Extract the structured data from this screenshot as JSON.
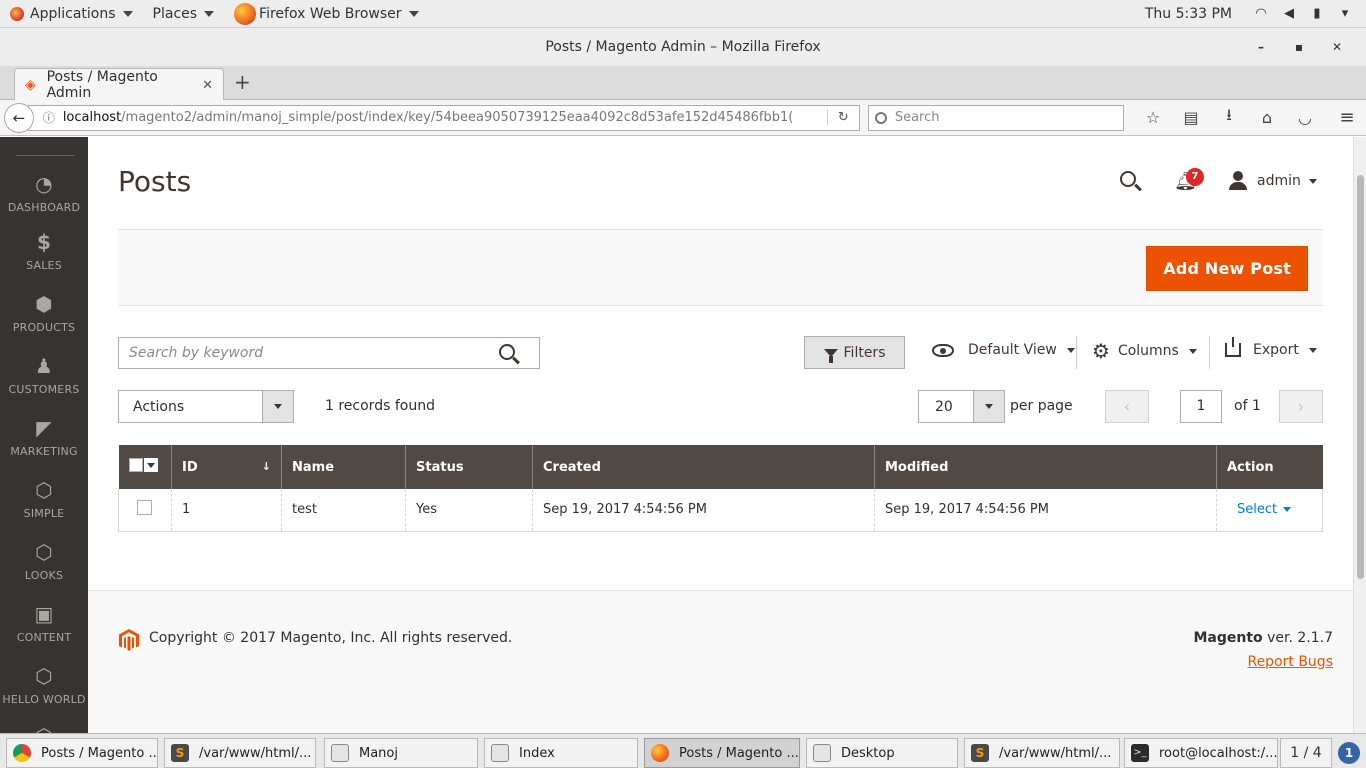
{
  "gnome": {
    "applications": "Applications",
    "places": "Places",
    "browser": "Firefox Web Browser",
    "clock": "Thu  5:33 PM"
  },
  "window": {
    "title": "Posts / Magento Admin – Mozilla Firefox",
    "minimize": "–",
    "maximize": "▪",
    "close": "✕"
  },
  "tab": {
    "label": "Posts / Magento Admin",
    "close": "✕",
    "new": "+"
  },
  "nav": {
    "url_host": "localhost",
    "url_path": "/magento2/admin/manoj_simple/post/index/key/54beea9050739125eaa4092c8d53afe152d45486fbb1(",
    "search_placeholder": "Search"
  },
  "sidebar": {
    "items": [
      {
        "label": "DASHBOARD",
        "icon": "dashboard-icon"
      },
      {
        "label": "SALES",
        "icon": "dollar-icon"
      },
      {
        "label": "PRODUCTS",
        "icon": "box-icon"
      },
      {
        "label": "CUSTOMERS",
        "icon": "person-icon"
      },
      {
        "label": "MARKETING",
        "icon": "megaphone-icon"
      },
      {
        "label": "SIMPLE",
        "icon": "hexagon-icon"
      },
      {
        "label": "LOOKS",
        "icon": "hexagon-icon"
      },
      {
        "label": "CONTENT",
        "icon": "layout-icon"
      },
      {
        "label": "HELLO WORLD",
        "icon": "hexagon-icon"
      }
    ]
  },
  "header": {
    "title": "Posts",
    "notifications": "7",
    "user": "admin"
  },
  "actionbar": {
    "add_button": "Add New Post"
  },
  "toolbar": {
    "search_placeholder": "Search by keyword",
    "filters": "Filters",
    "view": "Default View",
    "columns": "Columns",
    "export": "Export",
    "actions": "Actions",
    "records": "1 records found",
    "per_page_value": "20",
    "per_page_label": "per page",
    "page_value": "1",
    "page_of": "of 1"
  },
  "grid": {
    "headers": {
      "id": "ID",
      "sort": "↓",
      "name": "Name",
      "status": "Status",
      "created": "Created",
      "modified": "Modified",
      "action": "Action"
    },
    "rows": [
      {
        "id": "1",
        "name": "test",
        "status": "Yes",
        "created": "Sep 19, 2017 4:54:56 PM",
        "modified": "Sep 19, 2017 4:54:56 PM",
        "action": "Select"
      }
    ]
  },
  "footer": {
    "copyright": "Copyright © 2017 Magento, Inc. All rights reserved.",
    "brand": "Magento",
    "version": " ver. 2.1.7",
    "report": "Report Bugs"
  },
  "taskbar": {
    "tasks": [
      {
        "label": "Posts / Magento ...",
        "icon": "chrome-icon"
      },
      {
        "label": "/var/www/html/...",
        "icon": "sublime-icon"
      },
      {
        "label": "Manoj",
        "icon": "file-manager-icon"
      },
      {
        "label": "Index",
        "icon": "file-manager-icon"
      },
      {
        "label": "Posts / Magento ...",
        "icon": "firefox-icon"
      },
      {
        "label": "Desktop",
        "icon": "file-manager-icon"
      },
      {
        "label": "/var/www/html/...",
        "icon": "sublime-icon"
      },
      {
        "label": "root@localhost:/...",
        "icon": "terminal-icon"
      }
    ],
    "workspace": "1 / 4",
    "notifications": "1"
  },
  "colors": {
    "accent": "#eb5202",
    "sidebar": "#373330",
    "grid_header": "#514943",
    "link": "#007bdb"
  }
}
